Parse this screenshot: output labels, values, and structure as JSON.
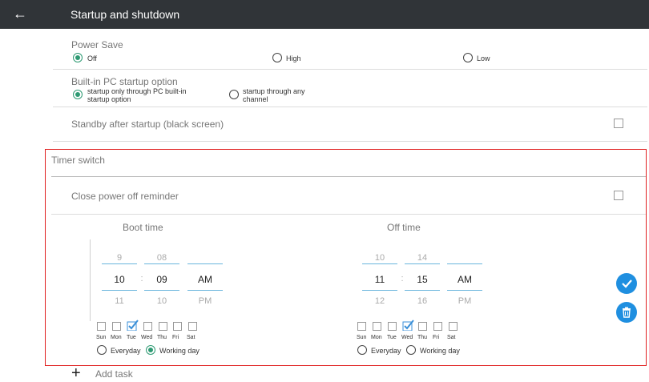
{
  "header": {
    "back_glyph": "←",
    "title": "Startup and shutdown"
  },
  "power_save": {
    "label": "Power Save",
    "options": [
      {
        "label": "Off",
        "selected": true
      },
      {
        "label": "High",
        "selected": false
      },
      {
        "label": "Low",
        "selected": false
      }
    ]
  },
  "builtin_pc": {
    "label": "Built-in PC startup option",
    "options": [
      {
        "label_line1": "startup only through PC built-in",
        "label_line2": "startup option",
        "selected": true
      },
      {
        "label_line1": "startup through any",
        "label_line2": "channel",
        "selected": false
      }
    ]
  },
  "standby": {
    "label": "Standby after startup (black screen)",
    "checked": false
  },
  "timer": {
    "label": "Timer switch",
    "reminder": {
      "label": "Close power off reminder",
      "checked": false
    },
    "boot": {
      "title": "Boot time",
      "hour": {
        "prev": "9",
        "current": "10",
        "next": "11"
      },
      "separator": ":",
      "minute": {
        "prev": "08",
        "current": "09",
        "next": "10"
      },
      "ampm": {
        "current": "AM",
        "next": "PM"
      },
      "days": [
        {
          "name": "Sun",
          "checked": false
        },
        {
          "name": "Mon",
          "checked": false
        },
        {
          "name": "Tue",
          "checked": true
        },
        {
          "name": "Wed",
          "checked": false
        },
        {
          "name": "Thu",
          "checked": false
        },
        {
          "name": "Fri",
          "checked": false
        },
        {
          "name": "Sat",
          "checked": false
        }
      ],
      "repeat": [
        {
          "label": "Everyday",
          "selected": false
        },
        {
          "label": "Working day",
          "selected": true
        }
      ]
    },
    "off": {
      "title": "Off time",
      "hour": {
        "prev": "10",
        "current": "11",
        "next": "12"
      },
      "separator": ":",
      "minute": {
        "prev": "14",
        "current": "15",
        "next": "16"
      },
      "ampm": {
        "current": "AM",
        "next": "PM"
      },
      "days": [
        {
          "name": "Sun",
          "checked": false
        },
        {
          "name": "Mon",
          "checked": false
        },
        {
          "name": "Tue",
          "checked": false
        },
        {
          "name": "Wed",
          "checked": true
        },
        {
          "name": "Thu",
          "checked": false
        },
        {
          "name": "Fri",
          "checked": false
        },
        {
          "name": "Sat",
          "checked": false
        }
      ],
      "repeat": [
        {
          "label": "Everyday",
          "selected": false
        },
        {
          "label": "Working day",
          "selected": false
        }
      ]
    },
    "confirm_icon": "check-icon",
    "delete_icon": "trash-icon"
  },
  "add_task": {
    "glyph": "+",
    "label": "Add task"
  },
  "colors": {
    "header_bg": "#303438",
    "accent": "#2e9a73",
    "fab": "#1f8fe0",
    "highlight": "#e02020"
  }
}
